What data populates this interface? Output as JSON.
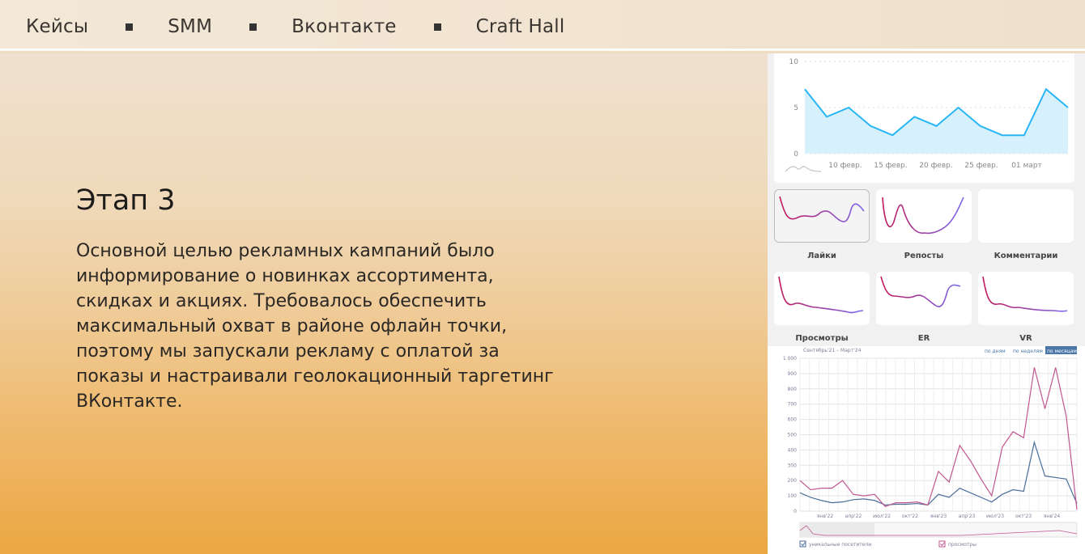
{
  "nav": {
    "items": [
      "Кейсы",
      "SMM",
      "Вконтакте",
      "Craft Hall"
    ]
  },
  "hero": {
    "title": "Этап 3",
    "text": "Основной целью рекламных кампаний было информирование о новинках ассортимента, скидках и акциях. Требовалось обеспечить максимальный охват в районе офлайн точки, поэтому мы запускали рекламу с оплатой за показы и настраивали геолокационный таргетинг ВКонтакте."
  },
  "colors": {
    "accent_blue": "#29b6f6",
    "accent_pink": "#c2185b",
    "accent_purple": "#7b68ee"
  },
  "chart_data": [
    {
      "type": "area",
      "y_ticks": [
        "10",
        "5",
        "0"
      ],
      "x_ticks": [
        "10 февр.",
        "15 февр.",
        "20 февр.",
        "25 февр.",
        "01 март"
      ],
      "ylim": [
        0,
        10
      ],
      "values": [
        7,
        4,
        5,
        3,
        2,
        4,
        3,
        5,
        3,
        2,
        2,
        7,
        5
      ]
    },
    {
      "type": "line",
      "minis": [
        {
          "label": "Лайки"
        },
        {
          "label": "Репосты"
        },
        {
          "label": "Комментарии"
        },
        {
          "label": "Просмотры"
        },
        {
          "label": "ER"
        },
        {
          "label": "VR"
        }
      ]
    },
    {
      "type": "line",
      "period": "Сентябрь'21 – Март'24",
      "toggles": [
        "по дням",
        "по неделям",
        "по месяцам"
      ],
      "y_ticks": [
        "1 000",
        "900",
        "800",
        "700",
        "600",
        "500",
        "400",
        "300",
        "200",
        "100",
        "0"
      ],
      "x_ticks": [
        "янв'22",
        "апр'22",
        "июл'22",
        "окт'22",
        "янв'23",
        "апр'23",
        "июл'23",
        "окт'23",
        "янв'24"
      ],
      "ylim": [
        0,
        1000
      ],
      "series": [
        {
          "name": "уникальные посетители",
          "values": [
            120,
            90,
            70,
            55,
            60,
            75,
            80,
            70,
            40,
            45,
            45,
            50,
            40,
            110,
            90,
            150,
            120,
            90,
            60,
            110,
            140,
            130,
            450,
            230,
            220,
            210,
            50
          ]
        },
        {
          "name": "просмотры",
          "values": [
            200,
            140,
            150,
            150,
            200,
            110,
            100,
            110,
            30,
            55,
            55,
            60,
            40,
            260,
            190,
            430,
            330,
            210,
            100,
            420,
            520,
            480,
            940,
            670,
            940,
            620,
            10
          ]
        }
      ]
    }
  ]
}
